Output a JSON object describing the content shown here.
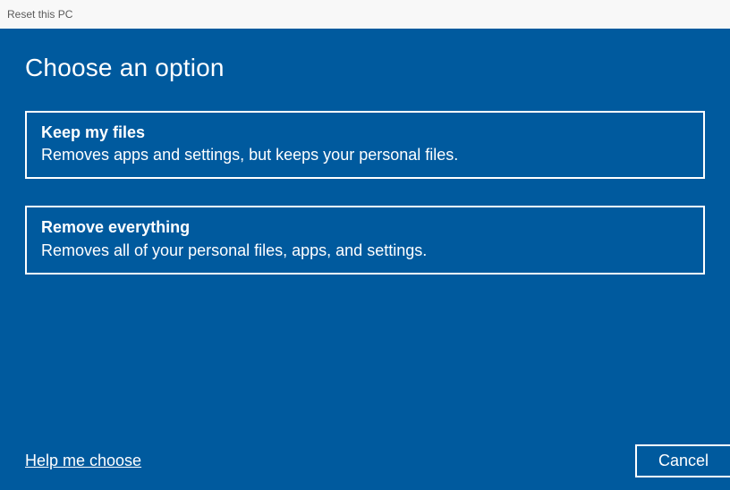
{
  "window": {
    "title": "Reset this PC"
  },
  "main": {
    "heading": "Choose an option",
    "options": [
      {
        "title": "Keep my files",
        "description": "Removes apps and settings, but keeps your personal files."
      },
      {
        "title": "Remove everything",
        "description": "Removes all of your personal files, apps, and settings."
      }
    ]
  },
  "footer": {
    "help_link": "Help me choose",
    "cancel_label": "Cancel"
  },
  "colors": {
    "background": "#005a9e",
    "foreground": "#ffffff",
    "titlebar_bg": "#f8f8f8",
    "titlebar_fg": "#5a5a5a"
  }
}
